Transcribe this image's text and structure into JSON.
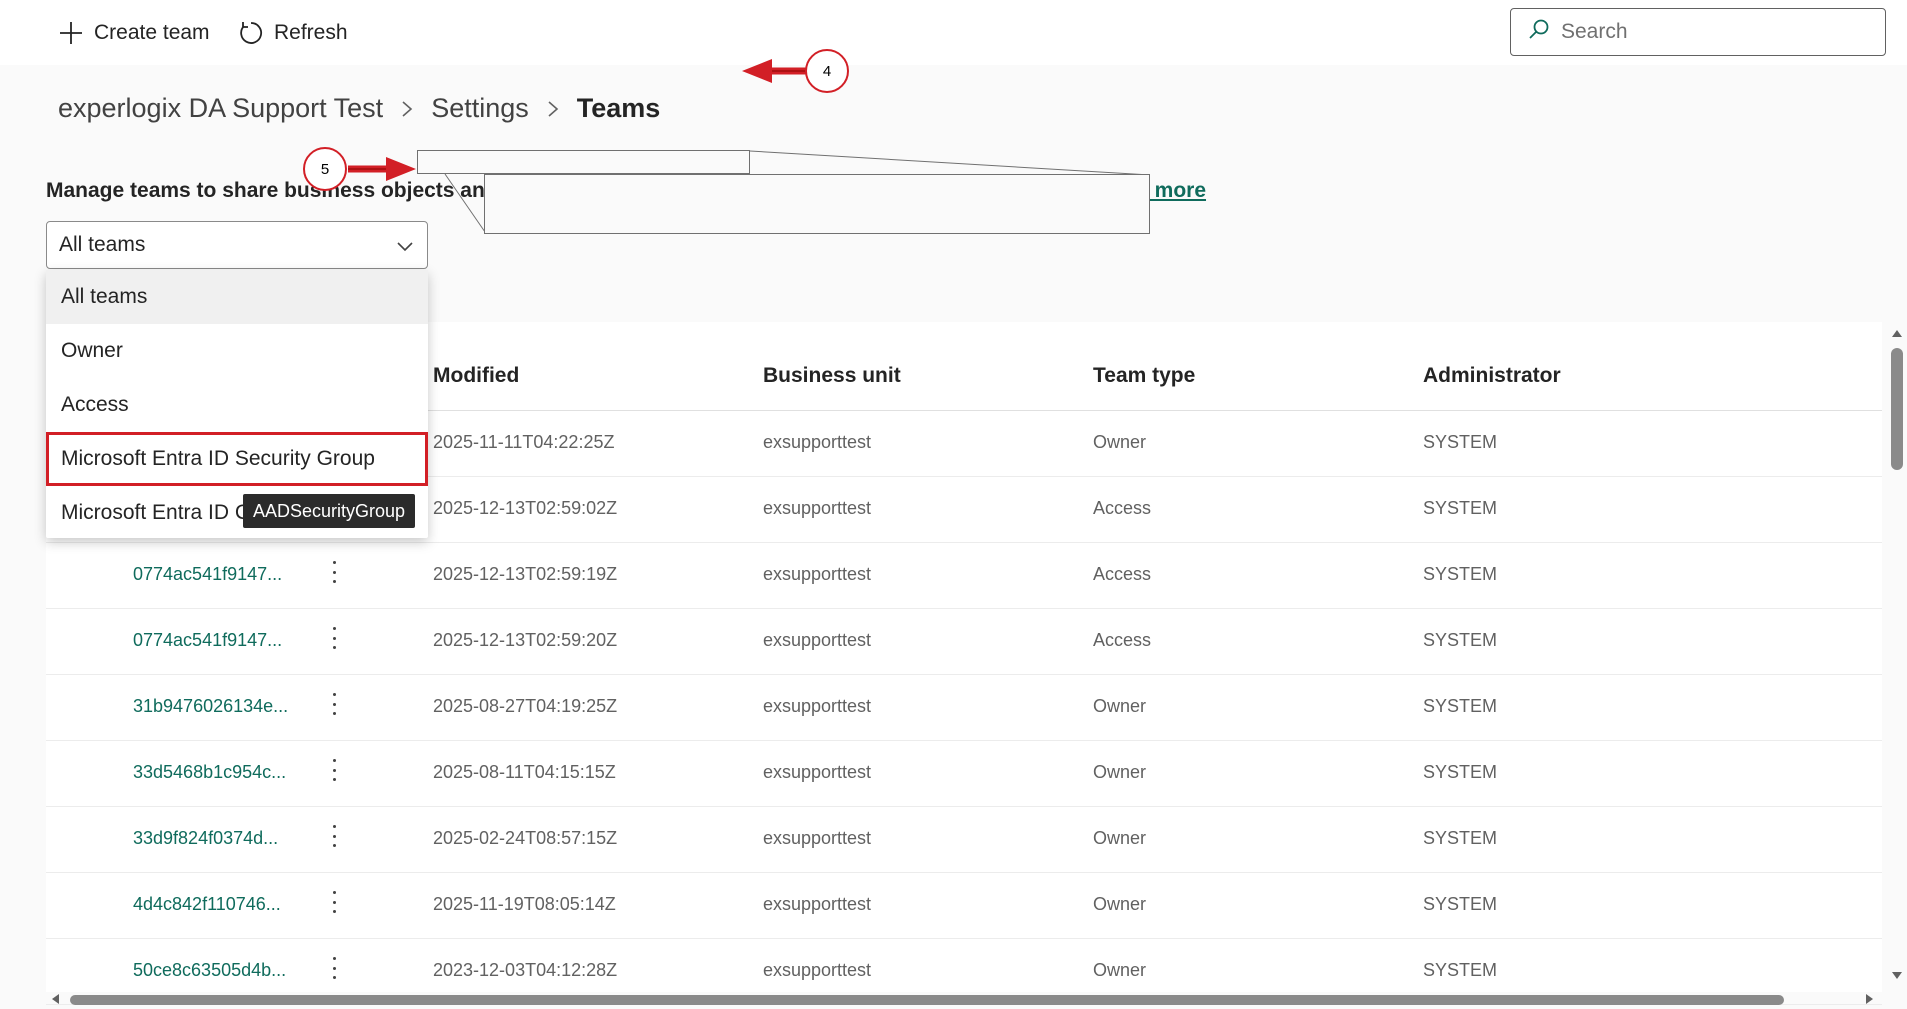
{
  "toolbar": {
    "create_label": "Create team",
    "refresh_label": "Refresh",
    "search_placeholder": "Search"
  },
  "breadcrumb": {
    "items": [
      "experlogix DA Support Test",
      "Settings",
      "Teams"
    ]
  },
  "description": "Manage teams to share business objects and",
  "learn_more": "n more",
  "filter": {
    "selected": "All teams",
    "options": [
      "All teams",
      "Owner",
      "Access",
      "Microsoft Entra ID Security Group",
      "Microsoft Entra ID C"
    ],
    "tooltip": "AADSecurityGroup"
  },
  "table": {
    "columns": [
      "Modified",
      "Business unit",
      "Team type",
      "Administrator"
    ],
    "rows": [
      {
        "name": "",
        "modified": "2025-11-11T04:22:25Z",
        "business_unit": "exsupporttest",
        "team_type": "Owner",
        "administrator": "SYSTEM"
      },
      {
        "name": "",
        "modified": "2025-12-13T02:59:02Z",
        "business_unit": "exsupporttest",
        "team_type": "Access",
        "administrator": "SYSTEM"
      },
      {
        "name": "0774ac541f9147...",
        "modified": "2025-12-13T02:59:19Z",
        "business_unit": "exsupporttest",
        "team_type": "Access",
        "administrator": "SYSTEM"
      },
      {
        "name": "0774ac541f9147...",
        "modified": "2025-12-13T02:59:20Z",
        "business_unit": "exsupporttest",
        "team_type": "Access",
        "administrator": "SYSTEM"
      },
      {
        "name": "31b9476026134e...",
        "modified": "2025-08-27T04:19:25Z",
        "business_unit": "exsupporttest",
        "team_type": "Owner",
        "administrator": "SYSTEM"
      },
      {
        "name": "33d5468b1c954c...",
        "modified": "2025-08-11T04:15:15Z",
        "business_unit": "exsupporttest",
        "team_type": "Owner",
        "administrator": "SYSTEM"
      },
      {
        "name": "33d9f824f0374d...",
        "modified": "2025-02-24T08:57:15Z",
        "business_unit": "exsupporttest",
        "team_type": "Owner",
        "administrator": "SYSTEM"
      },
      {
        "name": "4d4c842f110746...",
        "modified": "2025-11-19T08:05:14Z",
        "business_unit": "exsupporttest",
        "team_type": "Owner",
        "administrator": "SYSTEM"
      },
      {
        "name": "50ce8c63505d4b...",
        "modified": "2023-12-03T04:12:28Z",
        "business_unit": "exsupporttest",
        "team_type": "Owner",
        "administrator": "SYSTEM"
      }
    ]
  },
  "annotations": {
    "step_4": "4",
    "step_5": "5",
    "color": "#d21f26"
  },
  "colors": {
    "link": "#0f6b5c",
    "highlight_border": "#d21f26"
  }
}
